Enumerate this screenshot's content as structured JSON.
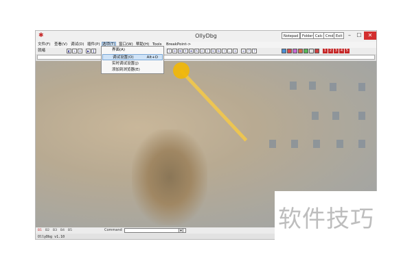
{
  "window": {
    "title": "OllyDbg",
    "title_buttons": [
      "Notepad",
      "Folder",
      "Calc",
      "Cmd",
      "Exit"
    ],
    "controls": {
      "minimize": "–",
      "maximize": "☐",
      "close": "✕"
    }
  },
  "menubar": {
    "items": [
      "文件(F)",
      "查看(V)",
      "调试(D)",
      "插件(P)",
      "选项(T)",
      "窗口(W)",
      "帮助(H)",
      "Tools",
      "BreakPoint->"
    ],
    "active_index": 4
  },
  "toolbar": {
    "status": "就绪",
    "color_buttons": [
      "#4a8fd6",
      "#d84a4a",
      "#c66ad1",
      "#d46a4a",
      "#5ab85a",
      "#e0e0e0",
      "#d04040"
    ],
    "number_buttons": [
      "1",
      "2",
      "3",
      "4",
      "5"
    ]
  },
  "dropdown": {
    "items": [
      {
        "label": "界面(A)",
        "shortcut": ""
      },
      {
        "label": "调试设置(O)",
        "shortcut": "Alt+O"
      },
      {
        "label": "实时调试设置(J)",
        "shortcut": ""
      },
      {
        "label": "添加到浏览器(E)",
        "shortcut": ""
      }
    ],
    "highlight_index": 1
  },
  "command": {
    "label": "Command",
    "value": ""
  },
  "lower_buttons": [
    "B1",
    "B2",
    "B3",
    "B4",
    "B5"
  ],
  "statusbar": {
    "text": "OllyDbg v1.10"
  },
  "watermark": {
    "text": "软件技巧"
  },
  "colors": {
    "accent_marker": "#f2b705",
    "close": "#d32f2f"
  }
}
